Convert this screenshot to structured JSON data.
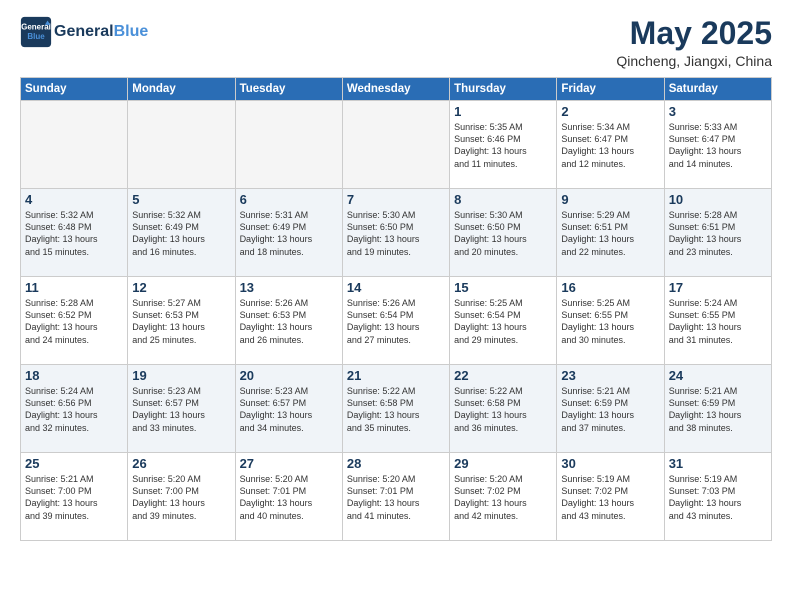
{
  "logo": {
    "line1": "General",
    "line2": "Blue"
  },
  "header": {
    "month_year": "May 2025",
    "location": "Qincheng, Jiangxi, China"
  },
  "weekdays": [
    "Sunday",
    "Monday",
    "Tuesday",
    "Wednesday",
    "Thursday",
    "Friday",
    "Saturday"
  ],
  "weeks": [
    [
      {
        "day": "",
        "content": ""
      },
      {
        "day": "",
        "content": ""
      },
      {
        "day": "",
        "content": ""
      },
      {
        "day": "",
        "content": ""
      },
      {
        "day": "1",
        "content": "Sunrise: 5:35 AM\nSunset: 6:46 PM\nDaylight: 13 hours\nand 11 minutes."
      },
      {
        "day": "2",
        "content": "Sunrise: 5:34 AM\nSunset: 6:47 PM\nDaylight: 13 hours\nand 12 minutes."
      },
      {
        "day": "3",
        "content": "Sunrise: 5:33 AM\nSunset: 6:47 PM\nDaylight: 13 hours\nand 14 minutes."
      }
    ],
    [
      {
        "day": "4",
        "content": "Sunrise: 5:32 AM\nSunset: 6:48 PM\nDaylight: 13 hours\nand 15 minutes."
      },
      {
        "day": "5",
        "content": "Sunrise: 5:32 AM\nSunset: 6:49 PM\nDaylight: 13 hours\nand 16 minutes."
      },
      {
        "day": "6",
        "content": "Sunrise: 5:31 AM\nSunset: 6:49 PM\nDaylight: 13 hours\nand 18 minutes."
      },
      {
        "day": "7",
        "content": "Sunrise: 5:30 AM\nSunset: 6:50 PM\nDaylight: 13 hours\nand 19 minutes."
      },
      {
        "day": "8",
        "content": "Sunrise: 5:30 AM\nSunset: 6:50 PM\nDaylight: 13 hours\nand 20 minutes."
      },
      {
        "day": "9",
        "content": "Sunrise: 5:29 AM\nSunset: 6:51 PM\nDaylight: 13 hours\nand 22 minutes."
      },
      {
        "day": "10",
        "content": "Sunrise: 5:28 AM\nSunset: 6:51 PM\nDaylight: 13 hours\nand 23 minutes."
      }
    ],
    [
      {
        "day": "11",
        "content": "Sunrise: 5:28 AM\nSunset: 6:52 PM\nDaylight: 13 hours\nand 24 minutes."
      },
      {
        "day": "12",
        "content": "Sunrise: 5:27 AM\nSunset: 6:53 PM\nDaylight: 13 hours\nand 25 minutes."
      },
      {
        "day": "13",
        "content": "Sunrise: 5:26 AM\nSunset: 6:53 PM\nDaylight: 13 hours\nand 26 minutes."
      },
      {
        "day": "14",
        "content": "Sunrise: 5:26 AM\nSunset: 6:54 PM\nDaylight: 13 hours\nand 27 minutes."
      },
      {
        "day": "15",
        "content": "Sunrise: 5:25 AM\nSunset: 6:54 PM\nDaylight: 13 hours\nand 29 minutes."
      },
      {
        "day": "16",
        "content": "Sunrise: 5:25 AM\nSunset: 6:55 PM\nDaylight: 13 hours\nand 30 minutes."
      },
      {
        "day": "17",
        "content": "Sunrise: 5:24 AM\nSunset: 6:55 PM\nDaylight: 13 hours\nand 31 minutes."
      }
    ],
    [
      {
        "day": "18",
        "content": "Sunrise: 5:24 AM\nSunset: 6:56 PM\nDaylight: 13 hours\nand 32 minutes."
      },
      {
        "day": "19",
        "content": "Sunrise: 5:23 AM\nSunset: 6:57 PM\nDaylight: 13 hours\nand 33 minutes."
      },
      {
        "day": "20",
        "content": "Sunrise: 5:23 AM\nSunset: 6:57 PM\nDaylight: 13 hours\nand 34 minutes."
      },
      {
        "day": "21",
        "content": "Sunrise: 5:22 AM\nSunset: 6:58 PM\nDaylight: 13 hours\nand 35 minutes."
      },
      {
        "day": "22",
        "content": "Sunrise: 5:22 AM\nSunset: 6:58 PM\nDaylight: 13 hours\nand 36 minutes."
      },
      {
        "day": "23",
        "content": "Sunrise: 5:21 AM\nSunset: 6:59 PM\nDaylight: 13 hours\nand 37 minutes."
      },
      {
        "day": "24",
        "content": "Sunrise: 5:21 AM\nSunset: 6:59 PM\nDaylight: 13 hours\nand 38 minutes."
      }
    ],
    [
      {
        "day": "25",
        "content": "Sunrise: 5:21 AM\nSunset: 7:00 PM\nDaylight: 13 hours\nand 39 minutes."
      },
      {
        "day": "26",
        "content": "Sunrise: 5:20 AM\nSunset: 7:00 PM\nDaylight: 13 hours\nand 39 minutes."
      },
      {
        "day": "27",
        "content": "Sunrise: 5:20 AM\nSunset: 7:01 PM\nDaylight: 13 hours\nand 40 minutes."
      },
      {
        "day": "28",
        "content": "Sunrise: 5:20 AM\nSunset: 7:01 PM\nDaylight: 13 hours\nand 41 minutes."
      },
      {
        "day": "29",
        "content": "Sunrise: 5:20 AM\nSunset: 7:02 PM\nDaylight: 13 hours\nand 42 minutes."
      },
      {
        "day": "30",
        "content": "Sunrise: 5:19 AM\nSunset: 7:02 PM\nDaylight: 13 hours\nand 43 minutes."
      },
      {
        "day": "31",
        "content": "Sunrise: 5:19 AM\nSunset: 7:03 PM\nDaylight: 13 hours\nand 43 minutes."
      }
    ]
  ]
}
